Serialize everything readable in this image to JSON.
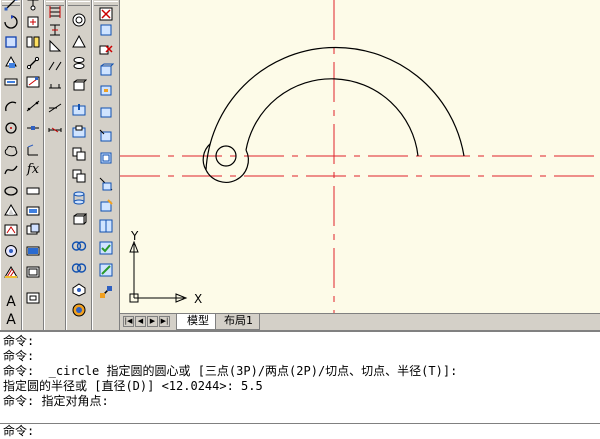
{
  "colors": {
    "canvas_bg": "#fdfbe8",
    "centerline": "#e0202a",
    "geometry": "#000000",
    "toolbar_bg": "#d4d0c8"
  },
  "toolbars": [
    {
      "name": "draw-toolbar",
      "icons": [
        "draw-line-icon",
        "xline-icon",
        "polyline-icon",
        "polygon-icon",
        "rectangle-icon",
        "arc-icon",
        "circle-icon",
        "revision-cloud-icon",
        "spline-icon",
        "ellipse-icon",
        "ellipse-arc-icon",
        "insert-block-icon",
        "make-block-icon",
        "point-icon",
        "hatch-icon",
        "gradient-icon",
        "region-icon",
        "table-icon",
        "text-icon"
      ]
    },
    {
      "name": "modify-toolbar",
      "icons": [
        "erase-icon",
        "copy-icon",
        "mirror-icon",
        "offset-icon",
        "array-icon",
        "move-icon",
        "rotate-icon",
        "scale-icon",
        "stretch-icon",
        "trim-icon",
        "extend-icon",
        "break-icon",
        "join-icon",
        "chamfer-icon",
        "fillet-icon",
        "explode-icon",
        "dim-linear-icon",
        "dim-aligned-icon",
        "formula-icon"
      ]
    },
    {
      "name": "modeling-toolbar-1",
      "icons": [
        "polysolid-icon",
        "sphere-icon",
        "cone-icon",
        "torus-icon",
        "helix-icon",
        "extrude-icon",
        "presspull-icon",
        "sweep-icon",
        "revolve-icon",
        "union-icon",
        "subtract-icon",
        "intersect-icon",
        "section-icon",
        "thicken-icon",
        "imprint-icon",
        "shell-icon",
        "separate-icon",
        "orbit-icon",
        "render-icon"
      ]
    },
    {
      "name": "modeling-toolbar-2",
      "icons": [
        "box-icon",
        "cylinder-icon",
        "wedge-icon",
        "pyramid-icon",
        "loft-icon",
        "slice-icon",
        "interfere-icon",
        "copy-face-icon",
        "color-face-icon",
        "extrude-face-icon",
        "move-face-icon",
        "offset-face-icon",
        "delete-face-icon",
        "rotate-face-icon",
        "taper-face-icon",
        "copy-edge-icon",
        "color-edge-icon",
        "clean-icon",
        "check-icon"
      ]
    }
  ],
  "text_tools": {
    "mtext_letter": "A",
    "formula_label": "fx"
  },
  "ucs": {
    "x_label": "X",
    "y_label": "Y"
  },
  "tabs": {
    "model": "模型",
    "layout1": "布局1"
  },
  "nav_buttons": [
    "first-tab-icon",
    "prev-tab-icon",
    "next-tab-icon",
    "last-tab-icon"
  ],
  "command_history": [
    "命令:",
    "命令:",
    "命令:  _circle 指定圆的圆心或 [三点(3P)/两点(2P)/切点、切点、半径(T)]:",
    "指定圆的半径或 [直径(D)] <12.0244>: 5.5",
    "命令: 指定对角点:"
  ],
  "command_prompt": "命令:"
}
